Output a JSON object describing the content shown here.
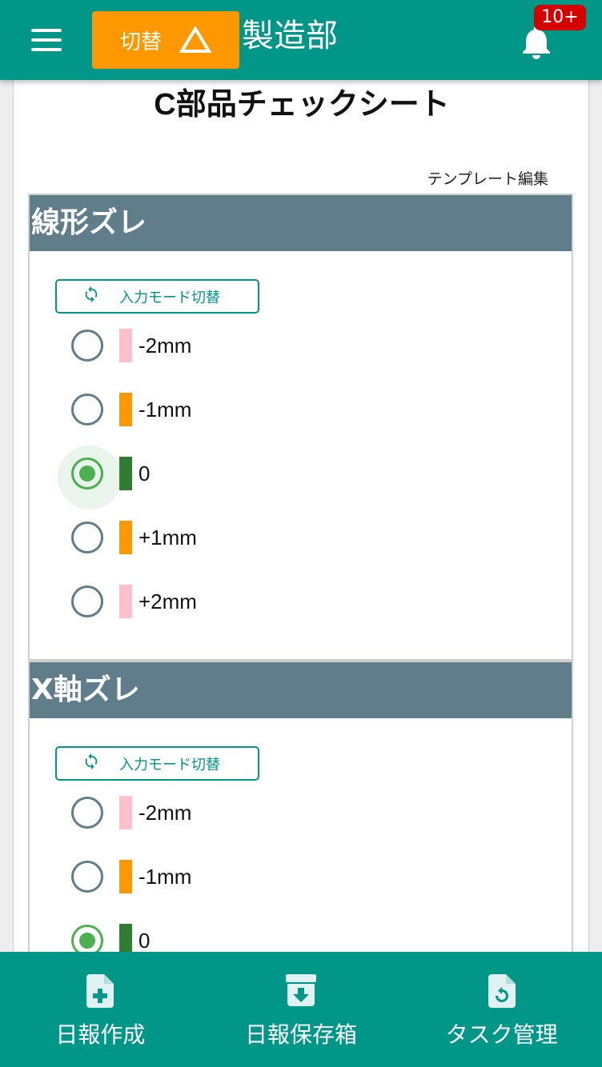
{
  "header": {
    "switch_label": "切替",
    "department": "製造部",
    "notification_count": "10+"
  },
  "page": {
    "title": "C部品チェックシート",
    "template_edit": "テンプレート編集"
  },
  "sections": [
    {
      "title": "線形ズレ",
      "mode_button": "入力モード切替",
      "selected": "0",
      "options": [
        {
          "label": "-2mm",
          "color": "#ffc0cb"
        },
        {
          "label": "-1mm",
          "color": "#ff9800"
        },
        {
          "label": "0",
          "color": "#2e7d32"
        },
        {
          "label": "+1mm",
          "color": "#ff9800"
        },
        {
          "label": "+2mm",
          "color": "#ffc0cb"
        }
      ]
    },
    {
      "title": "X軸ズレ",
      "mode_button": "入力モード切替",
      "selected": "0",
      "options": [
        {
          "label": "-2mm",
          "color": "#ffc0cb"
        },
        {
          "label": "-1mm",
          "color": "#ff9800"
        },
        {
          "label": "0",
          "color": "#2e7d32"
        }
      ]
    }
  ],
  "bottom_nav": [
    {
      "label": "日報作成",
      "icon": "file-add-icon"
    },
    {
      "label": "日報保存箱",
      "icon": "archive-icon"
    },
    {
      "label": "タスク管理",
      "icon": "file-refresh-icon"
    }
  ],
  "colors": {
    "primary": "#009688",
    "warning": "#ff9800",
    "section_header": "#607d8b",
    "badge": "#d50000",
    "checked": "#4caf50"
  }
}
